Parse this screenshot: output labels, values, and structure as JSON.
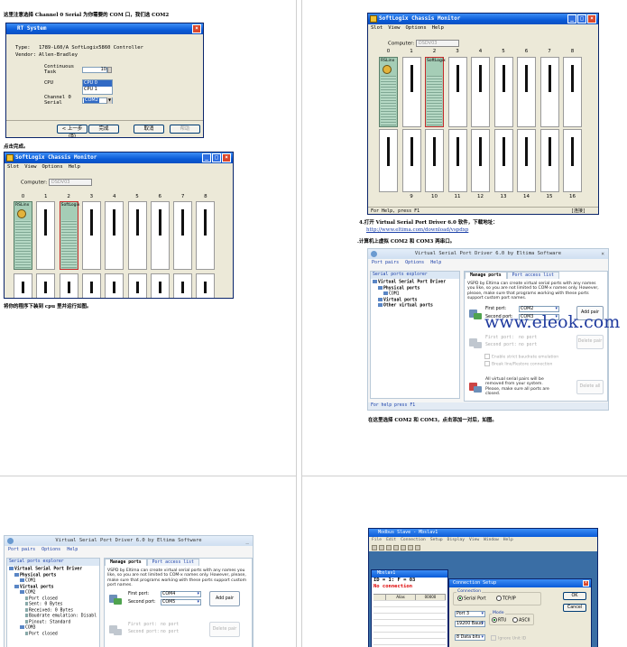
{
  "q1": {
    "note_top": "这里注意选择 Channel 0 Serial 为你需要的 COM 口，我们选 COM2",
    "rs_dialog": {
      "title": "RT System",
      "type_label": "Type:",
      "type_value": "1789-L60/A SoftLogix5860 Controller",
      "vendor_label": "Vendor:",
      "vendor_value": "Allen-Bradley",
      "continuous_label": "Continuous Task",
      "continuous_value": "10",
      "cpu_label": "CPU",
      "cpu_options": [
        "CPU 0",
        "CPU 1"
      ],
      "channel_label": "Channel 0 Serial",
      "channel_value": "COM2",
      "back_label": "< 上一步 (B)",
      "finish_label": "完成",
      "cancel_label": "取消",
      "help_label": "帮助"
    },
    "note_mid": "点击完成。",
    "chassis": {
      "title": "SoftLogix Chassis Monitor",
      "menu": [
        "Slot",
        "View",
        "Options",
        "Help"
      ],
      "computer_label": "Computer:",
      "computer_value": "DSDV03",
      "slots": [
        "0",
        "1",
        "2",
        "3",
        "4",
        "5",
        "6",
        "7",
        "8"
      ],
      "rslinx_label": "RSLinx",
      "softlogix_label": "SoftLogix"
    },
    "note_bottom": "将你的程序下装到 cpu 里并运行如图。"
  },
  "q2": {
    "chassis": {
      "title": "SoftLogix Chassis Monitor",
      "menu": [
        "Slot",
        "View",
        "Options",
        "Help"
      ],
      "computer_label": "Computer:",
      "computer_value": "DSDV03",
      "slots_top": [
        "0",
        "1",
        "2",
        "3",
        "4",
        "5",
        "6",
        "7",
        "8"
      ],
      "slots_bottom": [
        "9",
        "10",
        "11",
        "12",
        "13",
        "14",
        "15",
        "16"
      ],
      "rslinx_label": "RSLinx",
      "softlogix_label": "SoftLogix",
      "status": "For Help, press F1",
      "status_right": "[连接]"
    },
    "note_step4": "4.打开 Virtual Serial Port Driver 6.0 软件，下载地址：",
    "link": "http://www.eltima.com/download/vspdxp",
    "note_step5": ".计算机上虚拟 COM2 和 COM3 两串口。",
    "vspd": {
      "title": "Virtual Serial Port Driver 6.0 by Eltima Software",
      "menu": [
        "Port pairs",
        "Options",
        "Help"
      ],
      "explorer_header": "Serial ports explorer",
      "tree": [
        {
          "label": "Virtual Serial Port Driver",
          "indent": 0,
          "bold": true
        },
        {
          "label": "Physical ports",
          "indent": 1,
          "bold": true
        },
        {
          "label": "COM1",
          "indent": 2,
          "bold": false
        },
        {
          "label": "Virtual ports",
          "indent": 1,
          "bold": true
        },
        {
          "label": "Other virtual ports",
          "indent": 1,
          "bold": true
        }
      ],
      "tab_manage": "Manage ports",
      "tab_access": "Port access list",
      "desc": "VSPD by Eltima can create virtual serial ports with any names you like, so you are not limited to COM-x names only. However, please, make sure that programs working with these ports support custom port names.",
      "first_port_label": "First port:",
      "first_port_value": "COM2",
      "second_port_label": "Second port:",
      "second_port_value": "COM3",
      "add_pair": "Add pair",
      "pair_first_label": "First port:",
      "pair_first_value": "no port",
      "pair_second_label": "Second port:",
      "pair_second_value": "no port",
      "delete_pair": "Delete pair",
      "chk_strict": "Enable strict baudrate emulation",
      "chk_break": "Break line/Restore connection",
      "remove_desc": "All virtual serial pairs will be removed from your system. Please, make sure all ports are closed.",
      "delete_all": "Delete all",
      "status": "For help press F1"
    },
    "note_after": "在这里选择 COM2 和 COM3，点击添加一对后，如图。",
    "watermark": "www.eleok.com"
  },
  "q3": {
    "vspd": {
      "title": "Virtual Serial Port Driver 6.0 by Eltima Software",
      "menu": [
        "Port pairs",
        "Options",
        "Help"
      ],
      "explorer_header": "Serial ports explorer",
      "tree": [
        {
          "label": "Virtual Serial Port Driver",
          "indent": 0,
          "bold": true
        },
        {
          "label": "Physical ports",
          "indent": 1,
          "bold": true
        },
        {
          "label": "COM1",
          "indent": 2,
          "bold": false
        },
        {
          "label": "Virtual ports",
          "indent": 1,
          "bold": true
        },
        {
          "label": "COM2",
          "indent": 2,
          "bold": false
        },
        {
          "label": "Port closed",
          "indent": 3,
          "bold": false
        },
        {
          "label": "Sent: 0 Bytes",
          "indent": 3,
          "bold": false
        },
        {
          "label": "Received: 0 Bytes",
          "indent": 3,
          "bold": false
        },
        {
          "label": "Baudrate emulation: Disabl",
          "indent": 3,
          "bold": false
        },
        {
          "label": "Pinout: Standard",
          "indent": 3,
          "bold": false
        },
        {
          "label": "COM3",
          "indent": 2,
          "bold": false
        },
        {
          "label": "Port closed",
          "indent": 3,
          "bold": false
        }
      ],
      "tab_manage": "Manage ports",
      "tab_access": "Port access list",
      "desc": "VSPD by Eltima can create virtual serial ports with any names you like, so you are not limited to COM-x names only. However, please, make sure that programs working with these ports support custom port names.",
      "first_port_label": "First port:",
      "first_port_value": "COM4",
      "second_port_label": "Second port:",
      "second_port_value": "COM5",
      "add_pair": "Add pair",
      "pair_first_label": "First port:",
      "pair_first_value": "no port",
      "pair_second_label": "Second port:",
      "pair_second_value": "no port",
      "delete_pair": "Delete pair"
    }
  },
  "q4": {
    "modbus": {
      "title": "Modbus Slave - Mbslav1",
      "menu": [
        "File",
        "Edit",
        "Connection",
        "Setup",
        "Display",
        "View",
        "Window",
        "Help"
      ],
      "child_title": "Mbslav1",
      "id_line": "ID = 1: F = 03",
      "no_connection": "No connection",
      "grid_header": [
        "",
        "Alias",
        "00000"
      ],
      "dialog": {
        "title": "Connection Setup",
        "connection_group": "Connection",
        "serial_port": "Serial Port",
        "tcp_ip": "TCP/IP",
        "port_value": "Port 3",
        "baud_value": "19200 Baud",
        "data_value": "8 Data bits",
        "mode_group": "Mode",
        "rtu": "RTU",
        "ascii": "ASCII",
        "ignore_unit": "Ignore Unit ID",
        "ok": "OK",
        "cancel": "Cancel"
      }
    }
  }
}
